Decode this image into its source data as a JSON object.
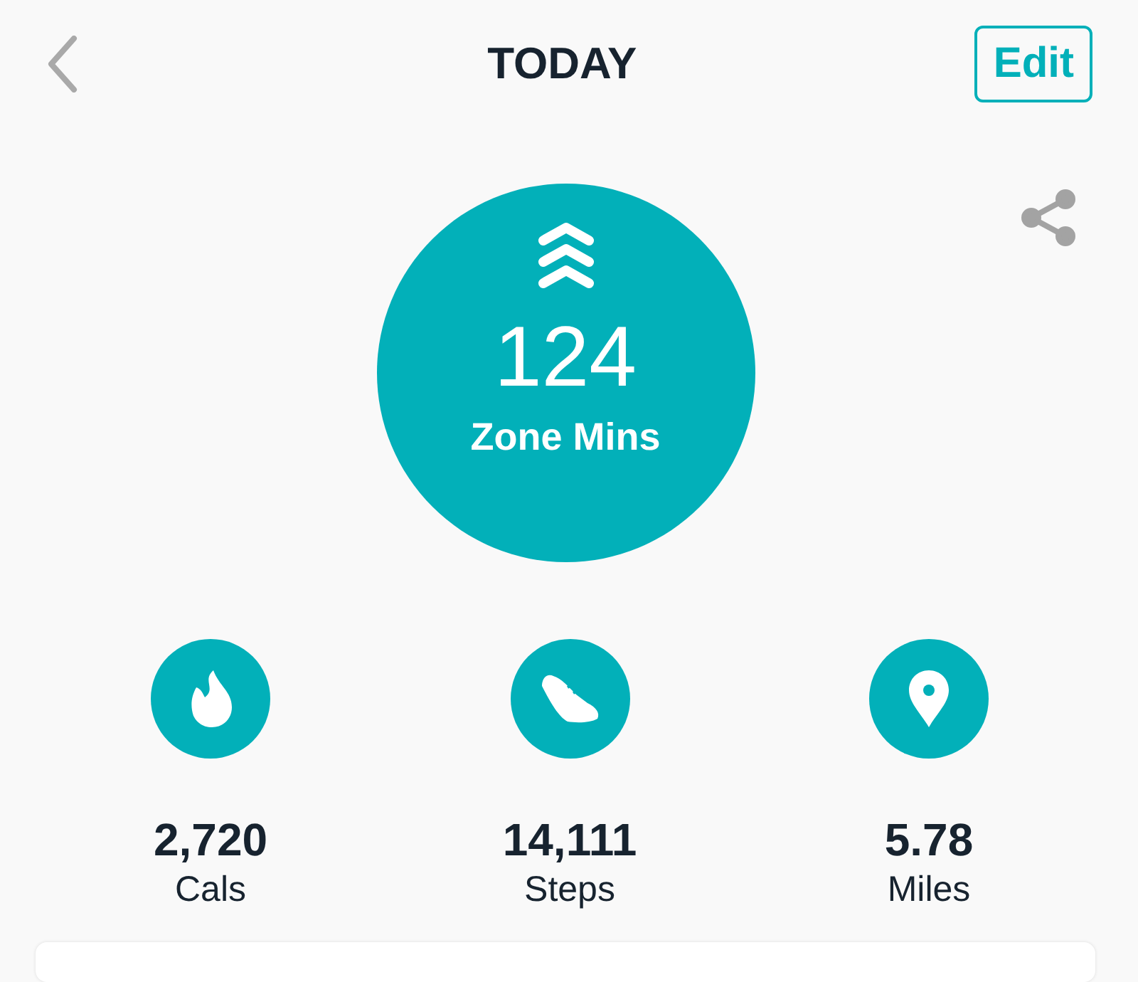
{
  "header": {
    "title": "TODAY",
    "edit_button": "Edit"
  },
  "hero": {
    "value": "124",
    "label": "Zone Mins"
  },
  "stats": [
    {
      "kind": "flame",
      "value": "2,720",
      "label": "Cals"
    },
    {
      "kind": "shoe",
      "value": "14,111",
      "label": "Steps"
    },
    {
      "kind": "pin",
      "value": "5.78",
      "label": "Miles"
    }
  ]
}
